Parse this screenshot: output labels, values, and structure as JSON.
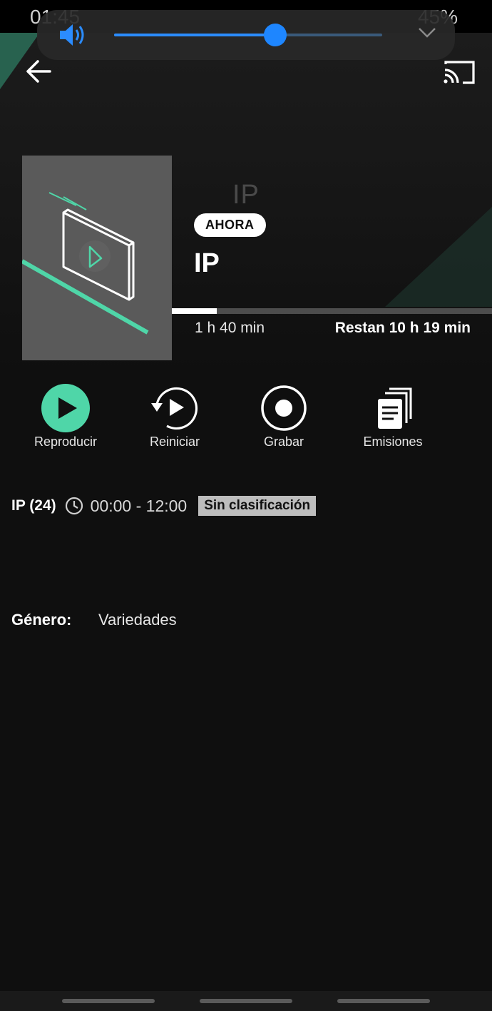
{
  "status": {
    "time": "01:45",
    "battery": "45%"
  },
  "colors": {
    "accent": "#4fd6a8",
    "volume": "#1e86ff",
    "background": "#0f0f0f"
  },
  "volume": {
    "level": 0.6
  },
  "header": {
    "back_icon": "arrow-left-icon",
    "cast_icon": "cast-icon"
  },
  "program": {
    "channel_logo": "IP",
    "badge": "AHORA",
    "title": "IP",
    "progress": 0.14,
    "elapsed": "1 h 40 min",
    "remaining": "Restan 10 h 19 min"
  },
  "actions": [
    {
      "label": "Reproducir",
      "icon": "play-icon"
    },
    {
      "label": "Reiniciar",
      "icon": "restart-icon"
    },
    {
      "label": "Grabar",
      "icon": "record-icon"
    },
    {
      "label": "Emisiones",
      "icon": "episodes-icon"
    }
  ],
  "info": {
    "channel": "IP (24)",
    "time_range": "00:00 - 12:00",
    "rating": "Sin clasificación"
  },
  "details": {
    "genre_label": "Género:",
    "genre_value": "Variedades"
  }
}
